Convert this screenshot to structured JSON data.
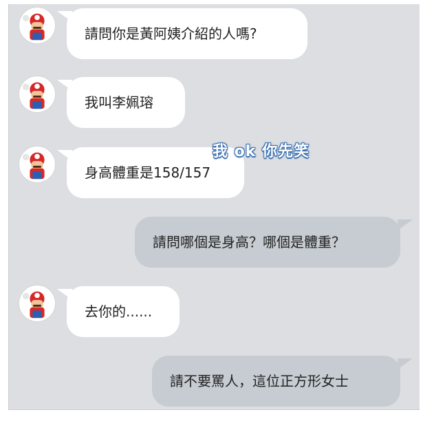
{
  "messages": [
    {
      "text": "請問你是黃阿姨介紹的人嗎?"
    },
    {
      "text": "我叫李姵瑢"
    },
    {
      "text": "身高體重是158/157"
    },
    {
      "text": "請問哪個是身高？哪個是體重？"
    },
    {
      "text": "去你的......"
    },
    {
      "text": "請不要罵人，這位正方形女士"
    }
  ],
  "overlay_caption": "我 ok 你先笑",
  "colors": {
    "left_bubble": "#ffffff",
    "right_bubble": "#c6ccd2",
    "background": "#dcdee1"
  },
  "avatar_icon": "mario-avatar-icon"
}
